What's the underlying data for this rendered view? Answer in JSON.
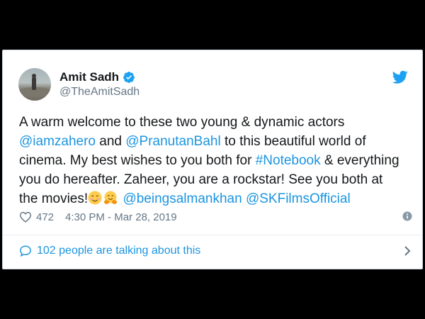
{
  "tweet": {
    "author_name": "Amit Sadh",
    "handle": "@TheAmitSadh",
    "text_line1": "A warm welcome to these two young & dynamic actors",
    "mention1": "@iamzahero",
    "text_and": " and ",
    "mention2": "@PranutanBahl",
    "text_line2_end": " to this beautiful world of",
    "text_line3": "cinema. My best wishes to you both for ",
    "hashtag": "#Notebook",
    "text_line3_end": " & everything",
    "text_line4": "you do hereafter. Zaheer, you are a rockstar! See you both at",
    "text_line5": "the movies!",
    "mention3": "@beingsalmankhan",
    "mention4": "@SKFilmsOfficial",
    "emojis": [
      "smiling-face-icon",
      "hugging-face-icon"
    ]
  },
  "meta": {
    "likes": "472",
    "timestamp": "4:30 PM - Mar 28, 2019"
  },
  "footer": {
    "talking_text": "102 people are talking about this"
  },
  "colors": {
    "link": "#1b95e0",
    "text": "#14171a",
    "muted": "#657786",
    "background": "#000000",
    "card": "#ffffff"
  }
}
